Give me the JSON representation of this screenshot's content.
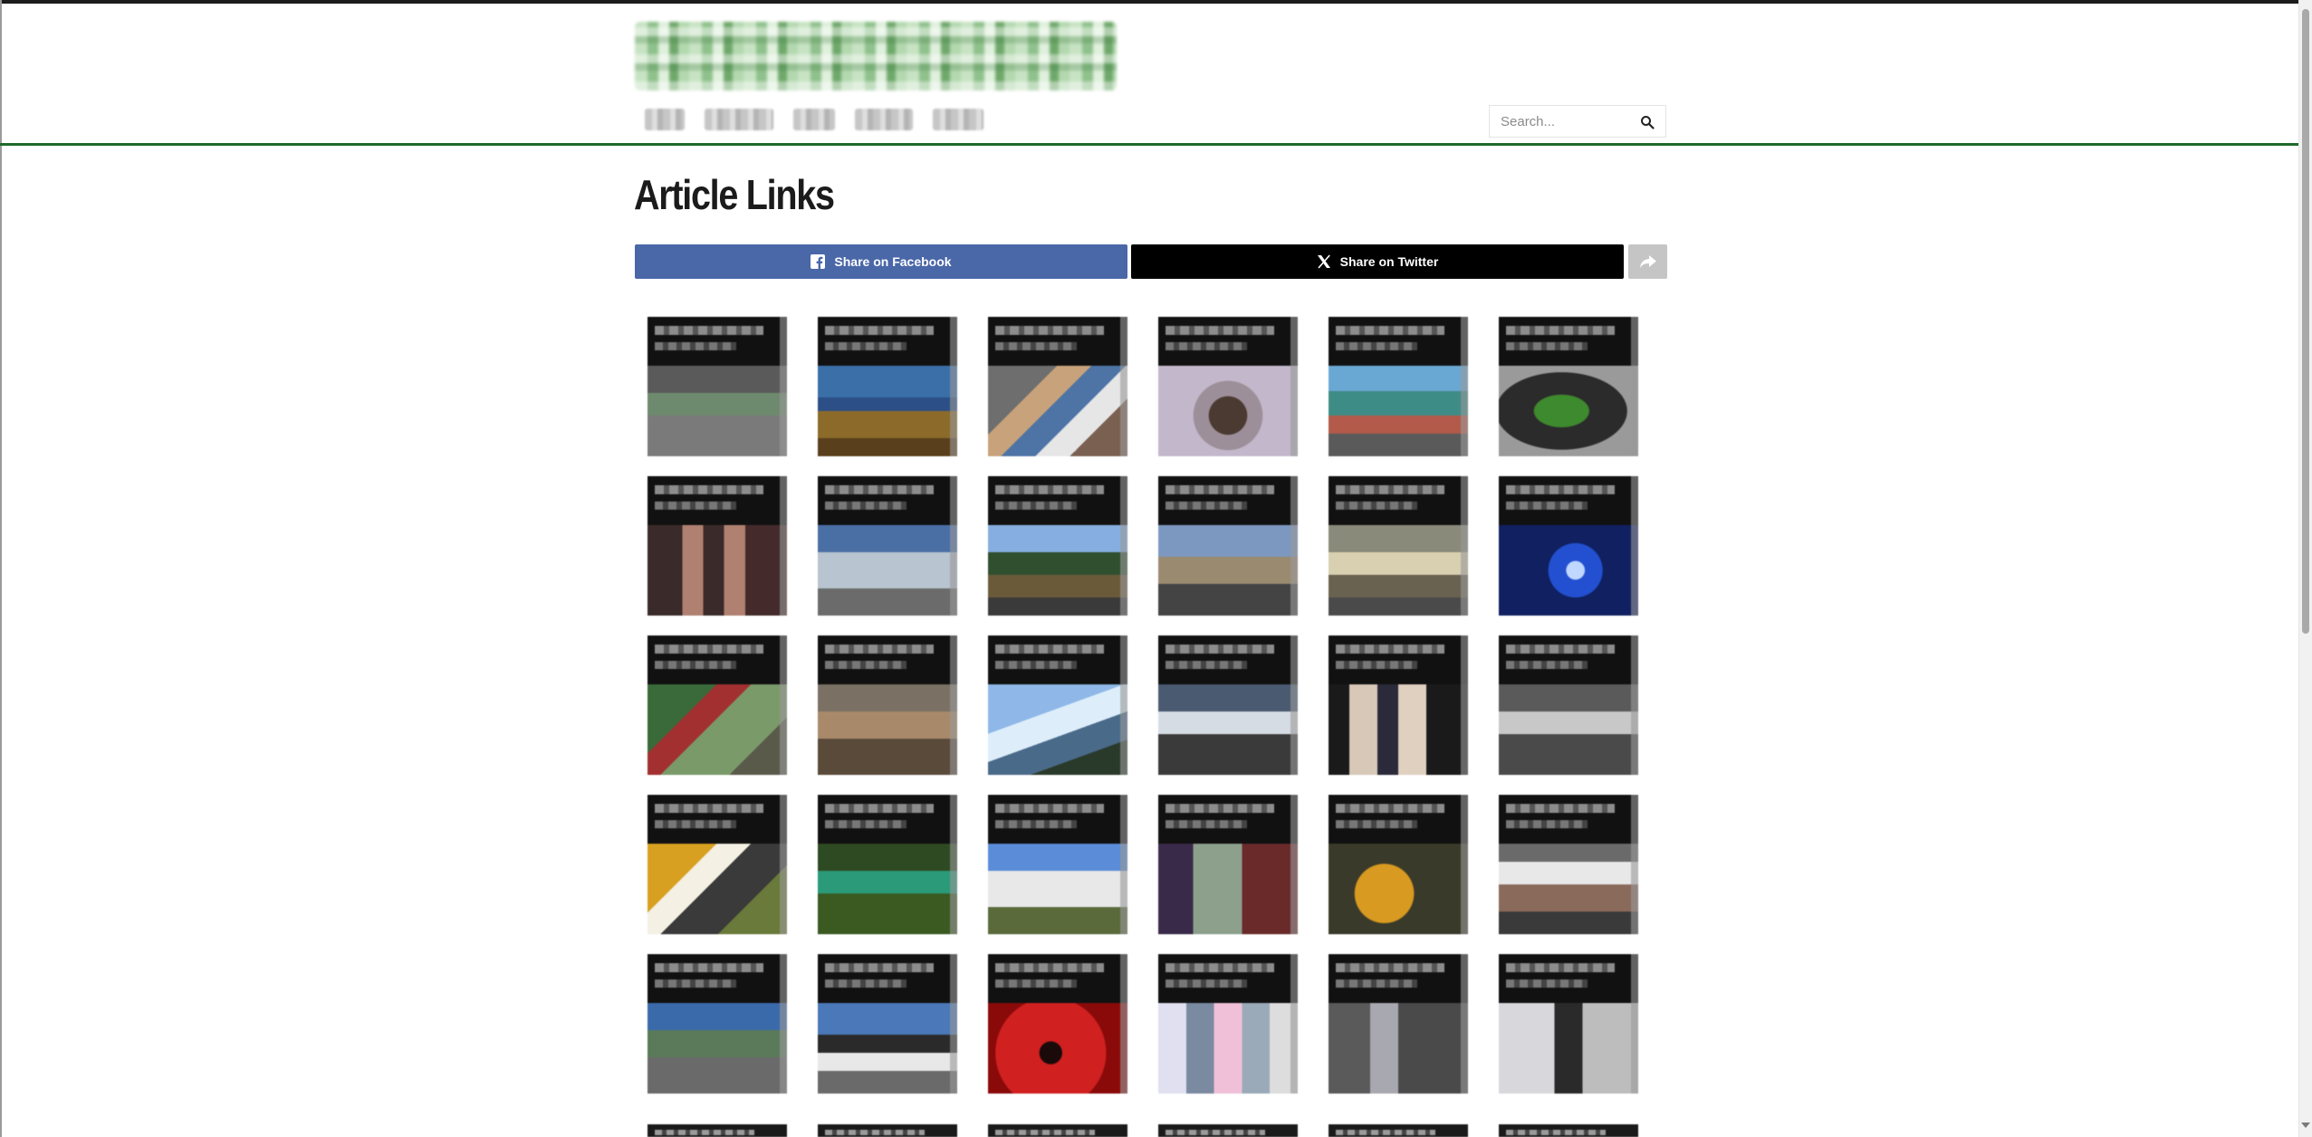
{
  "header": {
    "logo_alt": "",
    "nav_items": [
      "",
      "",
      "",
      "",
      ""
    ],
    "search": {
      "placeholder": "Search..."
    }
  },
  "page": {
    "title": "Article Links"
  },
  "share": {
    "facebook_label": "Share on Facebook",
    "twitter_label": "Share on Twitter"
  },
  "thumbnails": [
    {
      "img": "linear-gradient(180deg,#5a5a5a 0 30%,#6e8a6e 30% 55%,#7a7a7a 55% 100%)"
    },
    {
      "img": "linear-gradient(180deg,#3b6fa8 0 35%,#2b4f86 35% 50%,#8b6a2a 50% 80%,#5a3f1d 80% 100%)"
    },
    {
      "img": "linear-gradient(135deg,#6e6e6e 0 30%,#c7a27a 30% 45%,#4d74a5 45% 60%,#e6e6e6 60% 75%,#7a6050 75% 100%)"
    },
    {
      "img": "radial-gradient(circle at 50% 55%,#4a3a32 0 22%,#9d8f99 23% 40%,#c3b8cb 41% 100%)"
    },
    {
      "img": "linear-gradient(180deg,#6aa8d4 0 28%,#3e8c86 28% 55%,#b35a4a 55% 75%,#5a5a5a 75% 100%)"
    },
    {
      "img": "radial-gradient(ellipse at 45% 50%,#3e8a2e 0 25%,#2b2b2b 26% 60%,#9a9a9a 61% 100%)"
    },
    {
      "img": "linear-gradient(90deg,#3a2a2a 0 25%,#b08070 25% 40%,#3a2a2a 40% 55%,#b08070 55% 70%,#442a2a 70% 100%)"
    },
    {
      "img": "linear-gradient(180deg,#4a6fa5 0 30%,#b8c4cf 30% 70%,#6b6b6b 70% 100%)"
    },
    {
      "img": "linear-gradient(180deg,#86aee0 0 30%,#2f4f2f 30% 55%,#6b5a3a 55% 80%,#3a3a3a 80% 100%)"
    },
    {
      "img": "linear-gradient(180deg,#7c98c0 0 35%,#9a8a70 35% 65%,#444 65% 100%)"
    },
    {
      "img": "linear-gradient(180deg,#8a8a7a 0 30%,#d8d0b0 30% 55%,#6a6250 55% 80%,#4a4a4a 80% 100%)"
    },
    {
      "img": "radial-gradient(circle at 55% 50%,#c0d8ff 0 10%,#2250d0 11% 30%,#102060 31% 100%)"
    },
    {
      "img": "linear-gradient(135deg,#3a6a3a 0 30%,#a23030 30% 45%,#7a9a6a 45% 75%,#5a5a4a 75% 100%)"
    },
    {
      "img": "linear-gradient(180deg,#7a7064 0 30%,#a88a6a 30% 60%,#5a4a3a 60% 100%)"
    },
    {
      "img": "linear-gradient(160deg,#8fb8e8 0 35%,#ddeefa 35% 55%,#4a6a8a 55% 75%,#2a3a2a 75% 100%)"
    },
    {
      "img": "linear-gradient(180deg,#4a5a70 0 30%,#d6dce4 30% 55%,#3a3a3a 55% 100%)"
    },
    {
      "img": "linear-gradient(90deg,#1a1a1a 0 15%,#d8c8b8 15% 35%,#2a2a3a 35% 50%,#e0d0c0 50% 70%,#1a1a1a 70% 100%)"
    },
    {
      "img": "linear-gradient(180deg,#5a5a5a 0 30%,#c8c8c8 30% 55%,#4a4a4a 55% 100%)"
    },
    {
      "img": "linear-gradient(135deg,#d8a020 0 30%,#f4f0e4 30% 45%,#3a3a3a 45% 70%,#6a7a3a 70% 100%)"
    },
    {
      "img": "linear-gradient(180deg,#2e4a22 0 30%,#2a9a78 30% 55%,#3a5a22 55% 100%)"
    },
    {
      "img": "linear-gradient(180deg,#5a8cd8 0 30%,#e8e8e8 30% 70%,#5a6a3a 70% 100%)"
    },
    {
      "img": "linear-gradient(90deg,#3a2a4a 0 25%,#8ca08c 25% 60%,#6a2a2a 60% 100%)"
    },
    {
      "img": "radial-gradient(circle at 40% 55%,#d89a20 0 30%,#3a3a2a 31% 100%)"
    },
    {
      "img": "linear-gradient(180deg,#6a6a6a 0 20%,#e8e8e8 20% 45%,#8a6a5a 45% 75%,#3a3a3a 75% 100%)"
    },
    {
      "img": "linear-gradient(180deg,#3a6aaa 0 30%,#5a7a5a 30% 60%,#6a6a6a 60% 100%)"
    },
    {
      "img": "linear-gradient(180deg,#4a78b8 0 35%,#2a2a2a 35% 55%,#e8e8e8 55% 75%,#6a6a6a 75% 100%)"
    },
    {
      "img": "radial-gradient(circle at 45% 55%,#1a0a0a 0 12%,#d02020 13% 60%,#8a0a0a 61% 100%)"
    },
    {
      "img": "linear-gradient(90deg,#e0e0f0 0 20%,#7a8aa0 20% 40%,#f0c0d8 40% 60%,#9aaab8 60% 80%,#ddd 80% 100%)"
    },
    {
      "img": "linear-gradient(90deg,#5a5a5a 0 30%,#a8a8b0 30% 50%,#4a4a4a 50% 100%)"
    },
    {
      "img": "linear-gradient(90deg,#d8d8dc 0 40%,#2a2a2a 40% 60%,#bdbdbd 60% 100%)"
    }
  ]
}
